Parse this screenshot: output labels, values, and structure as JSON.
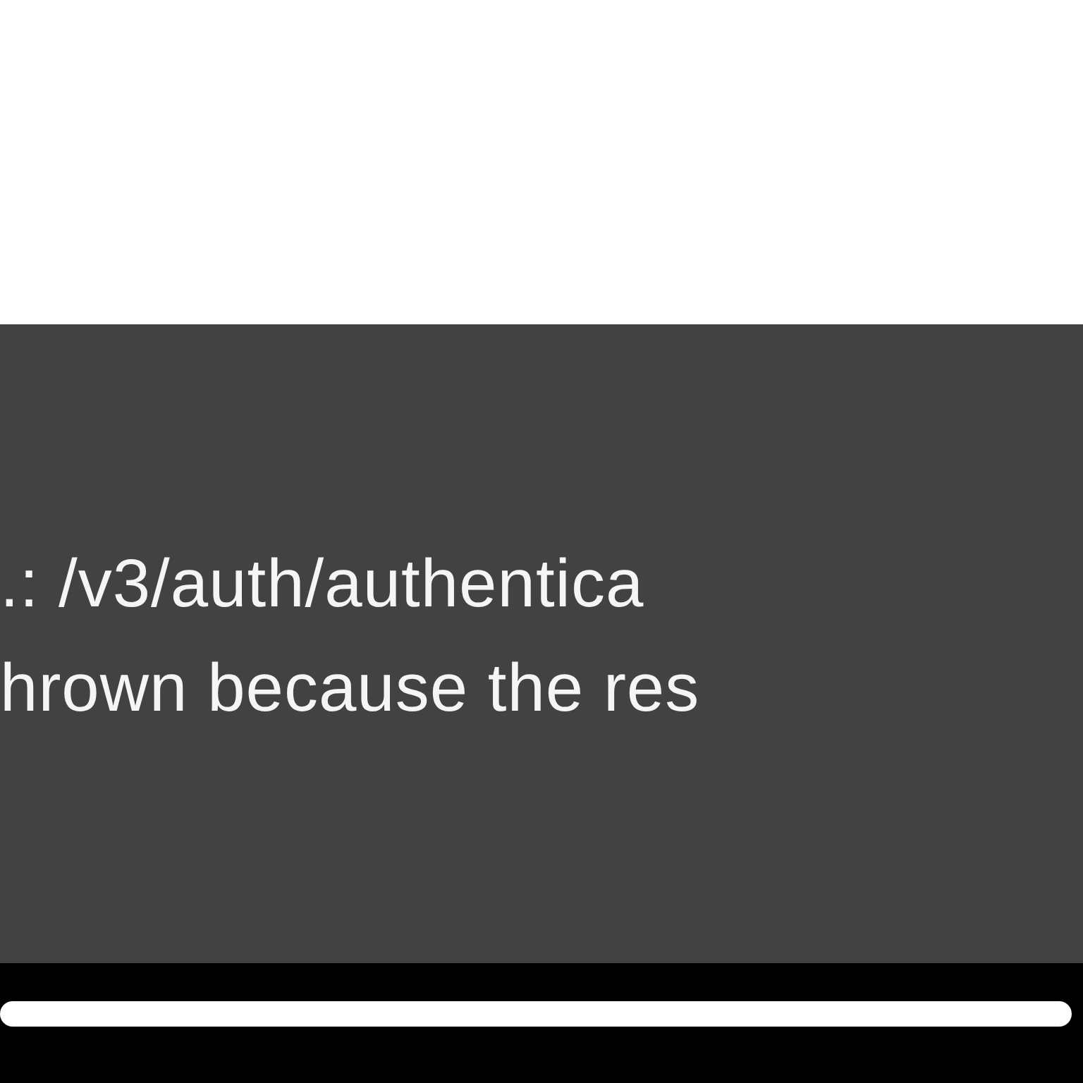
{
  "snackbar": {
    "lines": [
      ".: /v3/auth/authentica",
      "hrown because the res"
    ]
  }
}
